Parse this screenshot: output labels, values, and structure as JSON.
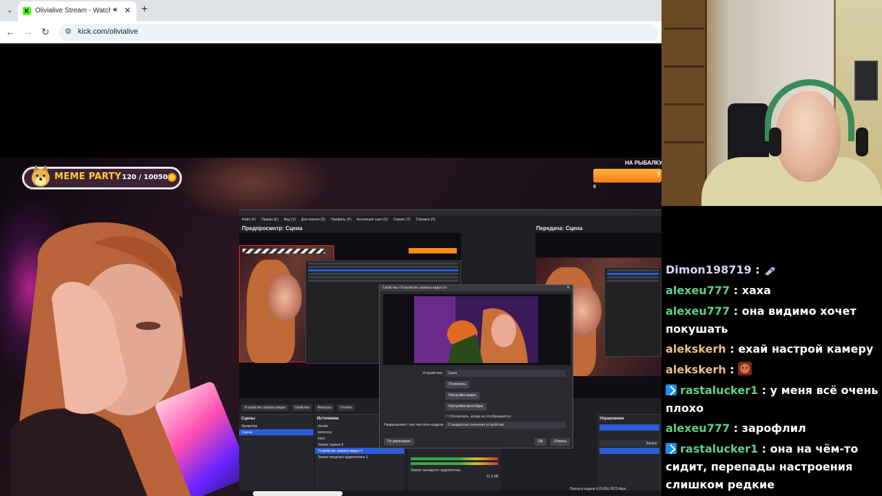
{
  "browser": {
    "tab_title": "Olivialive Stream - Watch Li",
    "favicon_letter": "K",
    "url": "kick.com/olivialive"
  },
  "overlay": {
    "meme_party_label": "MEME PARTY",
    "meme_party_count": "120 / 100500",
    "fishing_label": "НА РЫБАЛКУ",
    "fishing_value": "7",
    "fishing_zero": "0"
  },
  "obs": {
    "menu": [
      "Файл (F)",
      "Правка (E)",
      "Вид (V)",
      "Док-панели (D)",
      "Профиль (P)",
      "Коллекция сцен (S)",
      "Сервис (T)",
      "Справка (H)"
    ],
    "preview_header": "Предпросмотр: Сцена",
    "program_header": "Передача: Сцена",
    "source_bar": [
      "Устройство захвата видео",
      "Свойства",
      "Фильтры",
      "Отключ"
    ],
    "scenes_header": "Сцены",
    "scenes": [
      "Бравулер",
      "Сцена"
    ],
    "sources_header": "Источники",
    "sources": [
      "donate",
      "tamxxxxx",
      "stars",
      "Захват экрана 6",
      "Устройство захвата видео 3",
      "Захват входного аудиопотока 3"
    ],
    "mixer_label": "Захват выходного аудиопотока",
    "mixer_db": "-11.5 dB",
    "controls_header": "Управление",
    "controls_items": [
      "Запуск"
    ],
    "status": "Пропуск кадров 0 (0.0%)   2673 kbps"
  },
  "dialog": {
    "title": "Свойства «Устройство захвата видео 3»",
    "device_label": "Устройство",
    "device_value": "Camo",
    "deactivate_button": "Отключить",
    "video_settings_button": "Настройка видео",
    "crossbar_button": "Настройка кроссбара",
    "deactivate_checkbox": "Отключать, когда не отображается",
    "resolution_label": "Разрешение / тип частоты кадров",
    "resolution_value": "Стандартные значения устройства",
    "defaults_button": "По умолчанию",
    "ok_button": "OK",
    "cancel_button": "Отмена"
  },
  "chat": {
    "messages": [
      {
        "user": "Dimon198719",
        "color": "#d8d8ff",
        "text": "",
        "emote": "rocket",
        "badge": false
      },
      {
        "user": "alexeu777",
        "color": "#5fd08a",
        "text": "хаха",
        "badge": false
      },
      {
        "user": "alexeu777",
        "color": "#5fd08a",
        "text": "она видимо хочет покушать",
        "badge": false
      },
      {
        "user": "alekskerh",
        "color": "#e8c08a",
        "text": "ехай настрой камеру",
        "badge": false
      },
      {
        "user": "alekskerh",
        "color": "#e8c08a",
        "text": "",
        "emote": "face",
        "badge": false
      },
      {
        "user": "rastalucker1",
        "color": "#5fd08a",
        "text": "у меня всё очень плохо",
        "badge": true
      },
      {
        "user": "alexeu777",
        "color": "#5fd08a",
        "text": "зарофлил",
        "badge": false
      },
      {
        "user": "rastalucker1",
        "color": "#5fd08a",
        "text": "она на чём-то сидит, перепады настроения слишком редкие",
        "badge": true
      }
    ]
  }
}
